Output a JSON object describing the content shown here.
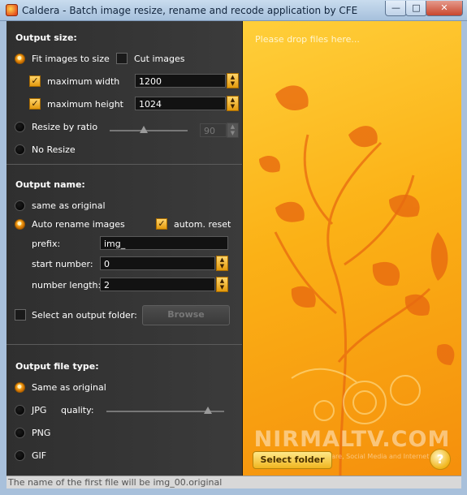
{
  "window": {
    "title": "Caldera - Batch image resize, rename and recode application by CFE",
    "min_glyph": "—",
    "max_glyph": "□",
    "close_glyph": "✕"
  },
  "output_size": {
    "title": "Output size:",
    "fit_label": "Fit images to size",
    "cut_label": "Cut images",
    "max_width_label": "maximum width",
    "max_width_value": "1200",
    "max_height_label": "maximum height",
    "max_height_value": "1024",
    "resize_ratio_label": "Resize by ratio",
    "ratio_value": "90",
    "no_resize_label": "No Resize"
  },
  "output_name": {
    "title": "Output name:",
    "same_label": "same as original",
    "auto_label": "Auto rename images",
    "autom_reset_label": "autom. reset",
    "prefix_label": "prefix:",
    "prefix_value": "img_",
    "start_label": "start number:",
    "start_value": "0",
    "length_label": "number length:",
    "length_value": "2",
    "folder_label": "Select an output folder:",
    "browse_label": "Browse"
  },
  "output_type": {
    "title": "Output file type:",
    "same_label": "Same as original",
    "jpg_label": "JPG",
    "quality_label": "quality:",
    "quality_level": 0.86,
    "png_label": "PNG",
    "gif_label": "GIF"
  },
  "drop_area": {
    "hint": "Please drop files here...",
    "select_folder_label": "Select folder",
    "help_glyph": "?",
    "watermark": "NIRMALTV.COM",
    "watermark_sub": "Tech News, Software, Social Media and Internet"
  },
  "status_bar": {
    "text": "The name of the first file will be img_00.original"
  },
  "colors": {
    "accent": "#f4a21b",
    "panel": "#333333",
    "drop_bg": "#fbb116"
  },
  "icons": {
    "spin_up": "▲",
    "spin_down": "▼",
    "check": "✓"
  }
}
